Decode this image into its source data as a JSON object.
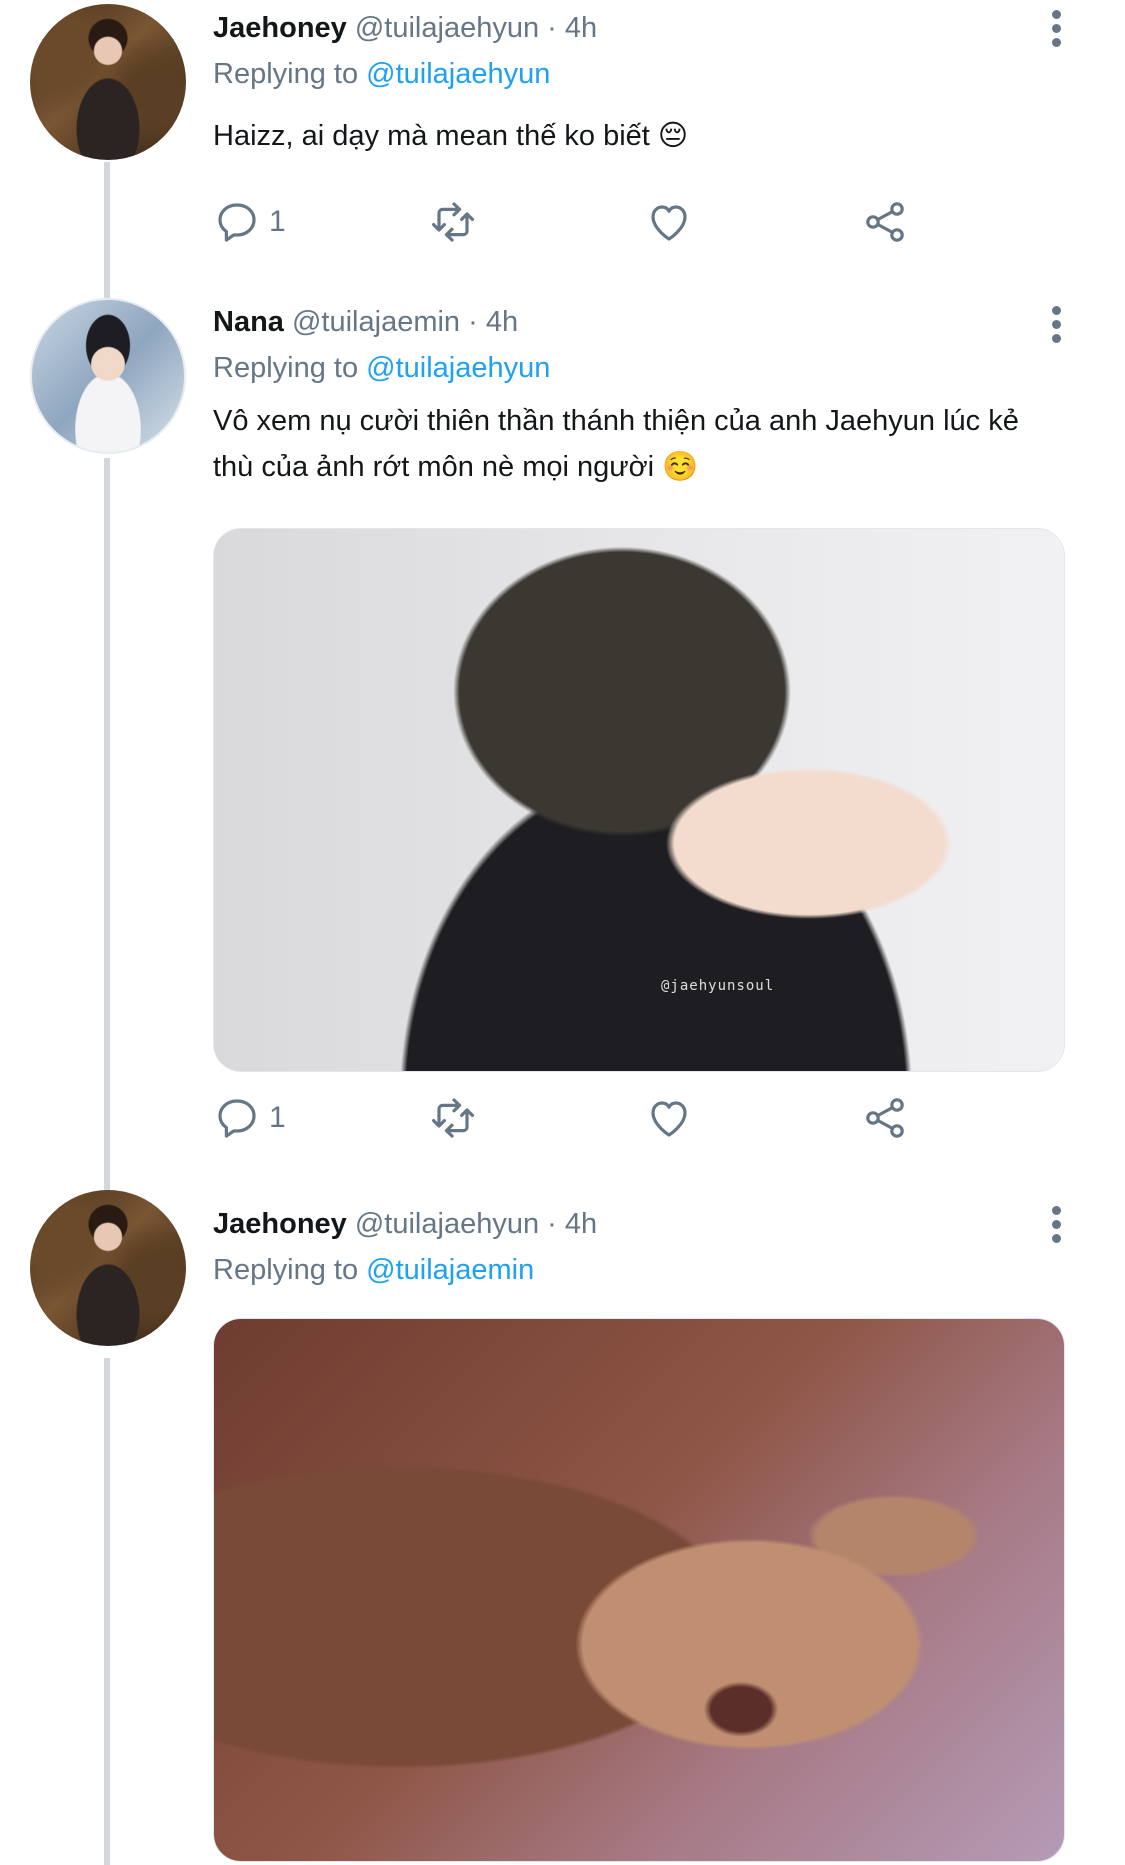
{
  "tweets": [
    {
      "name": "Jaehoney",
      "handle": "@tuilajaehyun",
      "separator": "·",
      "time": "4h",
      "replying_label": "Replying to",
      "replying_to": "@tuilajaehyun",
      "text": "Haizz, ai dạy mà mean thế ko biết 😔",
      "reply_count": "1",
      "avatar_icon": "avatar-jaehoney"
    },
    {
      "name": "Nana",
      "handle": "@tuilajaemin",
      "separator": "·",
      "time": "4h",
      "replying_label": "Replying to",
      "replying_to": "@tuilajaehyun",
      "text": "Vô xem nụ cười thiên thần thánh thiện của anh Jaehyun lúc kẻ thù của ảnh rớt môn nè mọi người ☺️",
      "media_watermark": "@jaehyunsoul",
      "reply_count": "1",
      "avatar_icon": "avatar-nana"
    },
    {
      "name": "Jaehoney",
      "handle": "@tuilajaehyun",
      "separator": "·",
      "time": "4h",
      "replying_label": "Replying to",
      "replying_to": "@tuilajaemin",
      "avatar_icon": "avatar-jaehoney"
    }
  ],
  "colors": {
    "link": "#1da1f2",
    "muted": "#657786",
    "thread_line": "#d4d8dc"
  }
}
